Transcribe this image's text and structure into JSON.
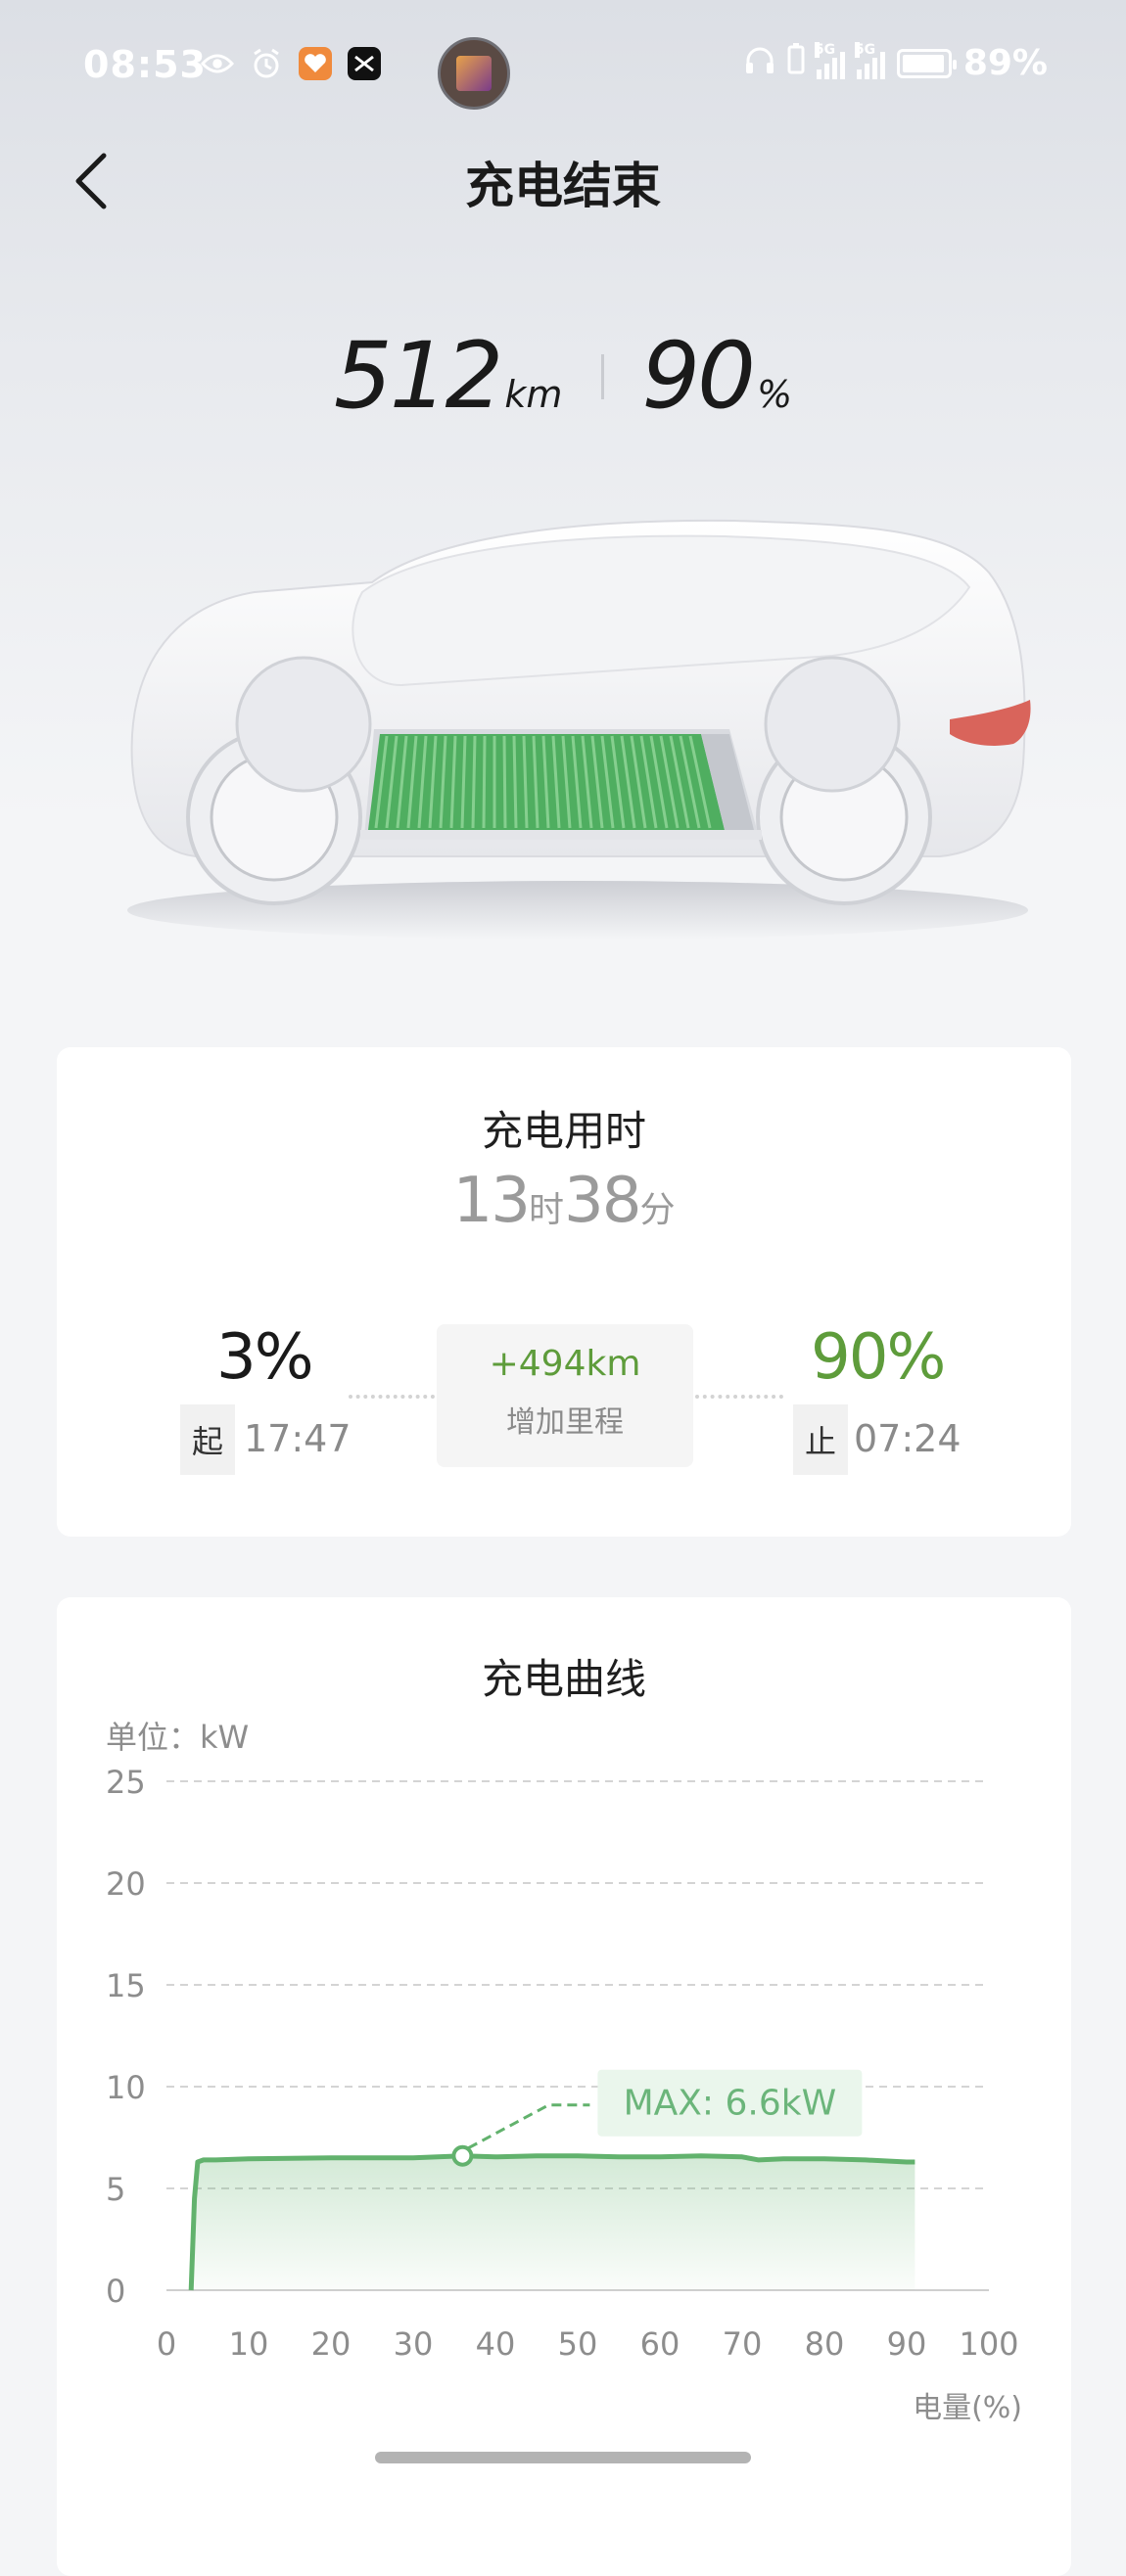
{
  "status_bar": {
    "time": "08:53",
    "battery_text": "89%",
    "signal_label": "5G",
    "icons": [
      "eye-icon",
      "alarm-icon",
      "heart-app-icon",
      "x-app-icon",
      "headphones-icon",
      "battery-saver-icon",
      "signal-icon",
      "battery-icon"
    ]
  },
  "header": {
    "title": "充电结束",
    "back_icon": "chevron-left-icon"
  },
  "range": {
    "km_value": "512",
    "km_unit": "km",
    "soc_value": "90",
    "soc_unit": "%"
  },
  "colors": {
    "green": "#62b26d",
    "accent_text": "#5e9c3b",
    "battery_cells": "#4fae60"
  },
  "duration_card": {
    "title": "充电用时",
    "hours": "13",
    "hours_unit": "时",
    "minutes": "38",
    "minutes_unit": "分",
    "start": {
      "percent": "3%",
      "tag": "起",
      "time": "17:47"
    },
    "gain": {
      "value": "+494km",
      "label": "增加里程"
    },
    "end": {
      "percent": "90%",
      "tag": "止",
      "time": "07:24"
    }
  },
  "curve_card": {
    "title": "充电曲线",
    "unit_label": "单位：kW",
    "max_label": "MAX: 6.6kW"
  },
  "chart_data": {
    "type": "line",
    "title": "充电曲线",
    "ylabel": "单位：kW",
    "xlabel": "电量(%)",
    "xlim": [
      0,
      100
    ],
    "ylim": [
      0,
      25
    ],
    "x_ticks": [
      "0",
      "10",
      "20",
      "30",
      "40",
      "50",
      "60",
      "70",
      "80",
      "90",
      "100"
    ],
    "y_ticks": [
      "0",
      "5",
      "10",
      "15",
      "20",
      "25"
    ],
    "grid": true,
    "series": [
      {
        "x": [
          3,
          3.4,
          3.8,
          4.5,
          6,
          10,
          20,
          30,
          36,
          40,
          45,
          50,
          55,
          60,
          65,
          70,
          72,
          75,
          80,
          85,
          90,
          91
        ],
        "y": [
          0,
          4.5,
          6.3,
          6.4,
          6.4,
          6.45,
          6.5,
          6.5,
          6.6,
          6.55,
          6.6,
          6.6,
          6.55,
          6.55,
          6.6,
          6.55,
          6.4,
          6.45,
          6.45,
          6.4,
          6.3,
          6.3
        ]
      }
    ],
    "annotation": {
      "label": "MAX: 6.6kW",
      "x": 36,
      "y": 6.6
    }
  }
}
